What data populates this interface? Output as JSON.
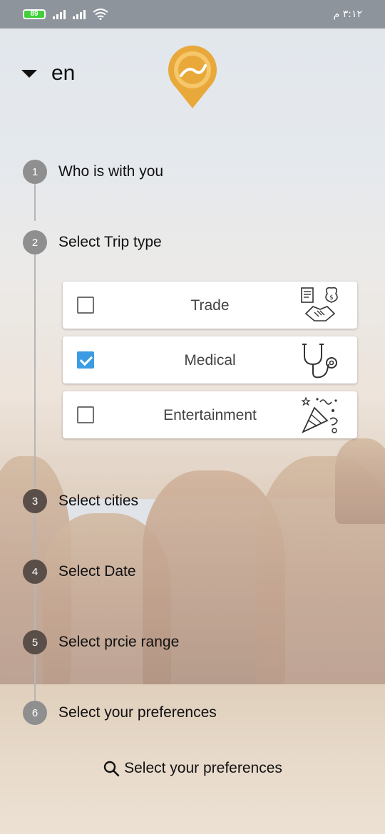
{
  "status_bar": {
    "battery": "89",
    "time": "٣:١٢ م"
  },
  "header": {
    "language": "en",
    "logo_color": "#e8a83a"
  },
  "steps": [
    {
      "number": "1",
      "label": "Who is with you"
    },
    {
      "number": "2",
      "label": "Select Trip type"
    },
    {
      "number": "3",
      "label": "Select cities"
    },
    {
      "number": "4",
      "label": "Select Date"
    },
    {
      "number": "5",
      "label": "Select prcie range"
    },
    {
      "number": "6",
      "label": "Select your preferences"
    }
  ],
  "trip_types": [
    {
      "label": "Trade",
      "checked": false,
      "icon": "handshake-money-icon"
    },
    {
      "label": "Medical",
      "checked": true,
      "icon": "stethoscope-icon"
    },
    {
      "label": "Entertainment",
      "checked": false,
      "icon": "party-popper-icon"
    }
  ],
  "bottom_button": {
    "label": "Select your preferences",
    "icon": "search-icon"
  },
  "colors": {
    "checkbox_checked": "#3b9be3",
    "status_bar": "#8e949c"
  }
}
